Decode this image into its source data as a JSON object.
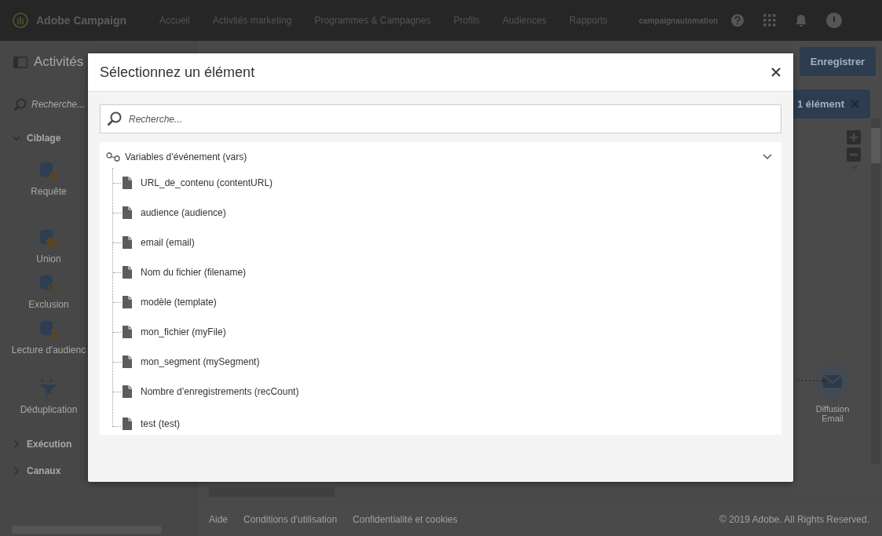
{
  "top_bar": {
    "product": "Adobe Campaign",
    "nav": [
      "Accueil",
      "Activités marketing",
      "Programmes & Campagnes",
      "Profils",
      "Audiences",
      "Rapports"
    ],
    "user": "campaignautomation"
  },
  "sidebar": {
    "title": "Activités",
    "search": {
      "placeholder": "Recherche..."
    },
    "sections": [
      {
        "label": "Ciblage",
        "expanded": true,
        "items": [
          {
            "label": "Requête",
            "kind": "query"
          },
          {
            "label": "Union",
            "kind": "union"
          },
          {
            "label": "Exclusion",
            "kind": "exclusion"
          },
          {
            "label": "Lecture d'audienc",
            "kind": "audience"
          },
          {
            "label": "Déduplication",
            "kind": "dedup"
          }
        ]
      },
      {
        "label": "Exécution",
        "expanded": false
      },
      {
        "label": "Canaux",
        "expanded": false
      }
    ]
  },
  "toolbar": {
    "save_button": "Enregistrer",
    "selection_chip": "1 élément"
  },
  "canvas": {
    "nodes": [
      {
        "label": "Diffusion Email",
        "kind": "email"
      }
    ]
  },
  "footer": {
    "links": [
      "Aide",
      "Conditions d'utilisation",
      "Confidentialité et cookies"
    ],
    "copyright": "© 2019 Adobe. All Rights Reserved."
  },
  "dialog": {
    "title": "Sélectionnez un élément",
    "search": {
      "placeholder": "Recherche..."
    },
    "tree": {
      "label": "Variables d’événement (vars)",
      "expanded": true,
      "children": [
        {
          "label": "URL_de_contenu (contentURL)"
        },
        {
          "label": "audience (audience)"
        },
        {
          "label": "email (email)"
        },
        {
          "label": "Nom du fichier (filename)"
        },
        {
          "label": "modèle (template)"
        },
        {
          "label": "mon_fichier (myFile)"
        },
        {
          "label": "mon_segment (mySegment)"
        },
        {
          "label": "Nombre d’enregistrements (recCount)"
        },
        {
          "label": "test (test)"
        }
      ]
    }
  }
}
